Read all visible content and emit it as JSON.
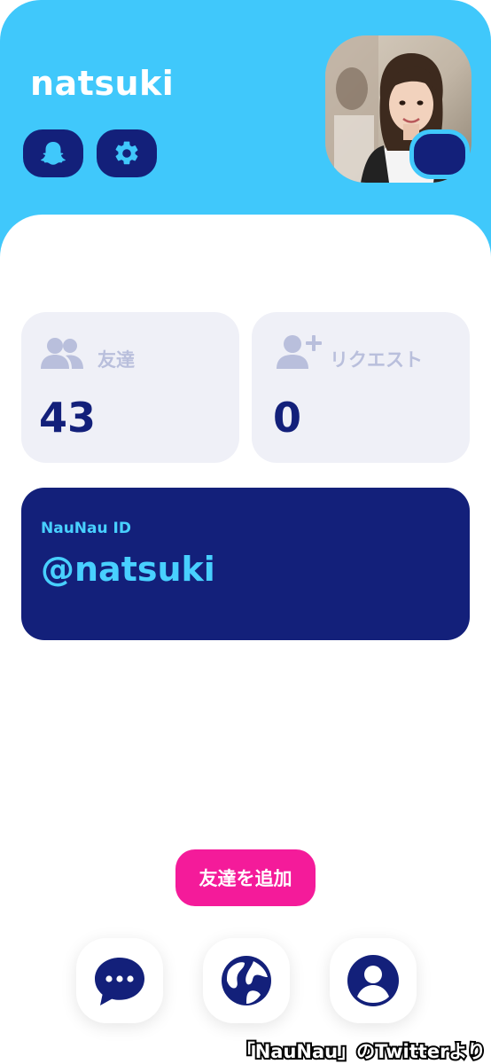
{
  "profile": {
    "username": "natsuki"
  },
  "stats": {
    "friends": {
      "label": "友達",
      "value": "43",
      "icon": "people-icon"
    },
    "requests": {
      "label": "リクエスト",
      "value": "0",
      "icon": "person-add-icon"
    }
  },
  "id_card": {
    "label": "NauNau ID",
    "value": "@natsuki"
  },
  "actions": {
    "add_friend": "友達を追加"
  },
  "bottom_nav": [
    "chat-bubble-icon",
    "globe-icon",
    "account-icon"
  ],
  "watermark": "「NauNau」のTwitterより",
  "colors": {
    "header_bg": "#40c8fb",
    "navy": "#13207a",
    "accent_cyan": "#48d0ff",
    "pink": "#f41b9a",
    "card_bg": "#eff0f7",
    "muted_label": "#b9bfdc"
  }
}
